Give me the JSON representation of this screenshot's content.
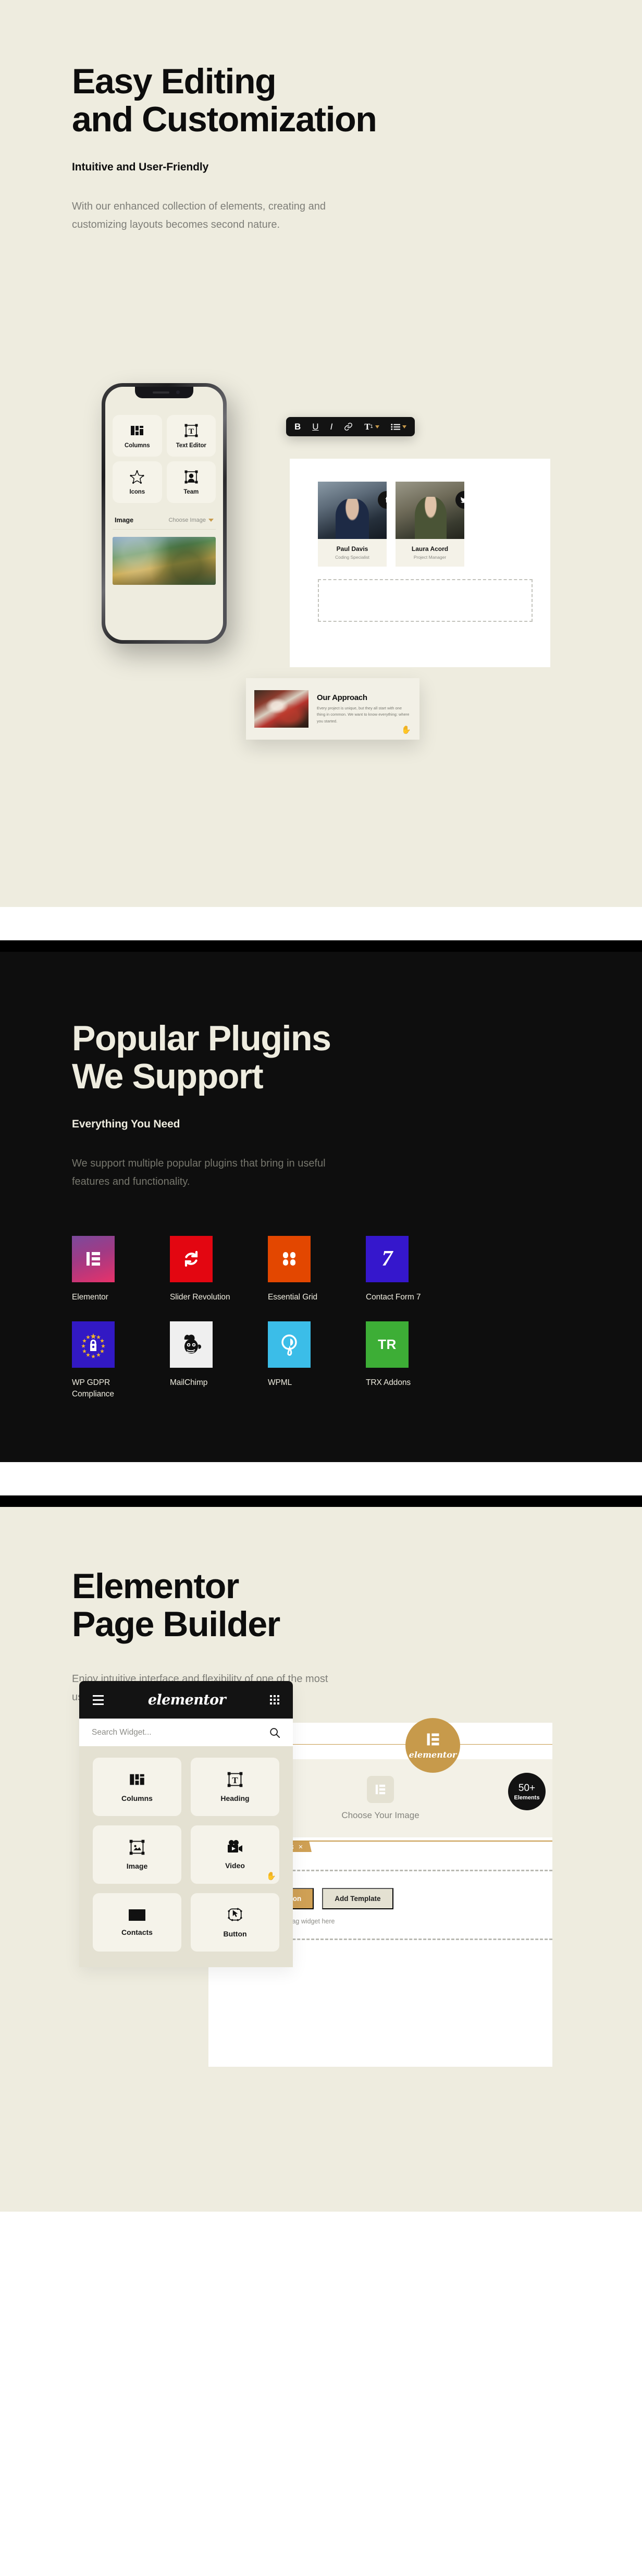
{
  "section_editing": {
    "heading_line1": "Easy Editing",
    "heading_line2": "and Customization",
    "subheading": "Intuitive and User-Friendly",
    "body": "With our enhanced collection of elements, creating and customizing layouts becomes second nature.",
    "phone": {
      "widgets": [
        {
          "label": "Columns",
          "icon": "columns-icon"
        },
        {
          "label": "Text Editor",
          "icon": "text-editor-icon"
        },
        {
          "label": "Icons",
          "icon": "star-icon"
        },
        {
          "label": "Team",
          "icon": "team-icon"
        }
      ],
      "image_row": {
        "label": "Image",
        "value": "Choose Image"
      }
    },
    "toolbar": {
      "bold": "B",
      "underline": "U",
      "italic": "I",
      "link": "link-icon",
      "text_size": "T",
      "text_size_sub": "1",
      "list": "list-icon"
    },
    "team": [
      {
        "name": "Paul Davis",
        "role": "Coding Specialist",
        "social": "facebook"
      },
      {
        "name": "Laura Acord",
        "role": "Project Manager",
        "social": "twitter"
      }
    ],
    "approach_card": {
      "title": "Our Approach",
      "text": "Every project is unique, but they all start with one thing in common. We want to know everything: where you started."
    }
  },
  "section_plugins": {
    "heading_line1": "Popular Plugins",
    "heading_line2": "We Support",
    "subheading": "Everything You Need",
    "body": "We support multiple popular plugins that bring in useful features and functionality.",
    "plugins": [
      {
        "label": "Elementor",
        "icon": "elementor-logo-icon",
        "tile_class": "t-elementor",
        "color": "#e8326a"
      },
      {
        "label": "Slider Revolution",
        "icon": "refresh-circle-icon",
        "tile_class": "t-slider",
        "color": "#e30611"
      },
      {
        "label": "Essential Grid",
        "icon": "four-dots-grid-icon",
        "tile_class": "t-essential",
        "color": "#e34700"
      },
      {
        "label": "Contact Form 7",
        "icon": "number-seven-icon",
        "tile_class": "t-cf7",
        "color": "#3517cc"
      },
      {
        "label": "WP GDPR Compliance",
        "icon": "eu-lock-icon",
        "tile_class": "t-gdpr",
        "color": "#3219c4"
      },
      {
        "label": "MailChimp",
        "icon": "mailchimp-monkey-icon",
        "tile_class": "t-mailchimp",
        "color": "#efefef"
      },
      {
        "label": "WPML",
        "icon": "wpml-logo-icon",
        "tile_class": "t-wpml",
        "color": "#3bbde8"
      },
      {
        "label": "TRX Addons",
        "icon": "trx-logo-icon",
        "tile_class": "t-trx",
        "color": "#3dae36"
      }
    ]
  },
  "section_builder": {
    "heading_line1": "Elementor",
    "heading_line2": "Page Builder",
    "body": "Enjoy intuitive interface and flexibility of one of the most user-friendly page builders for WordPress.",
    "panel": {
      "brand": "elementor",
      "search_placeholder": "Search Widget...",
      "widgets": [
        {
          "label": "Columns",
          "icon": "columns-icon"
        },
        {
          "label": "Heading",
          "icon": "heading-icon"
        },
        {
          "label": "Image",
          "icon": "image-icon"
        },
        {
          "label": "Video",
          "icon": "video-camera-icon"
        },
        {
          "label": "Contacts",
          "icon": "envelope-icon"
        },
        {
          "label": "Button",
          "icon": "button-icon"
        }
      ]
    },
    "canvas": {
      "choose_image": "Choose Your Image",
      "add_new_section": "Add New Section",
      "add_template": "Add Template",
      "drag_hint": "Or drag widget here"
    },
    "badge_brand": "elementor",
    "badge_count_number": "50+",
    "badge_count_label": "Elements"
  },
  "theme": {
    "cream": "#eeecdf",
    "dark": "#0e0e0e",
    "gold": "#c79a4b",
    "muted": "#7e7e78"
  }
}
